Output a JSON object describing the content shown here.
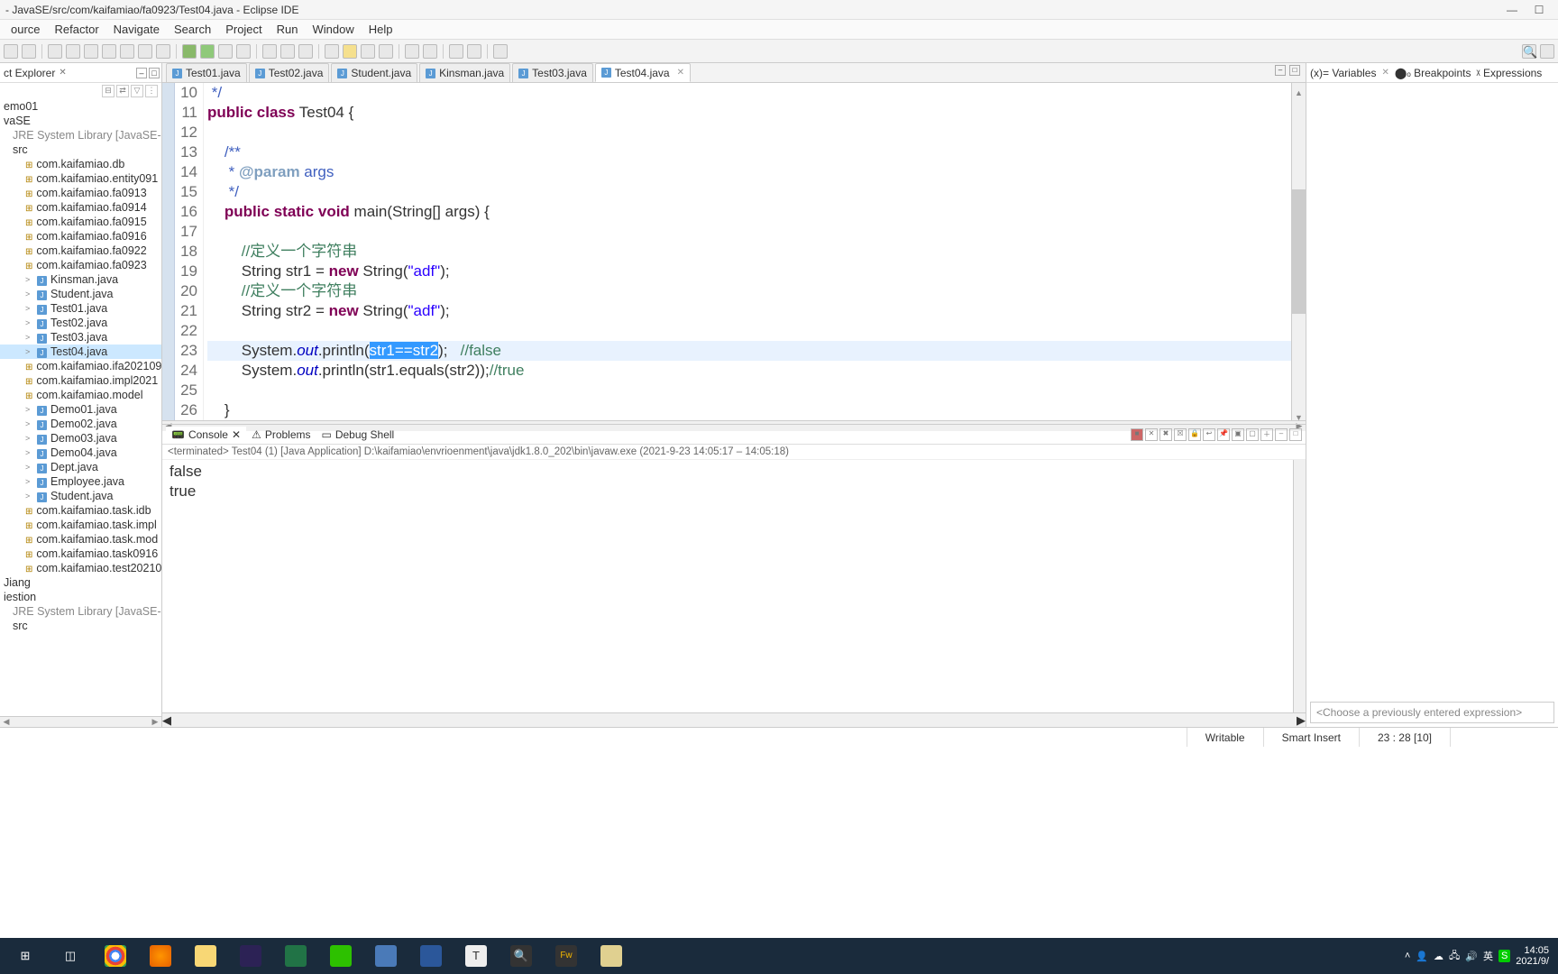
{
  "window": {
    "title": " - JavaSE/src/com/kaifamiao/fa0923/Test04.java - Eclipse IDE",
    "min": "—",
    "max": "☐",
    "close": "✕"
  },
  "menus": [
    "ource",
    "Refactor",
    "Navigate",
    "Search",
    "Project",
    "Run",
    "Window",
    "Help"
  ],
  "explorer": {
    "title": "ct Explorer",
    "items": [
      {
        "t": "emo01",
        "cls": ""
      },
      {
        "t": "vaSE",
        "cls": ""
      },
      {
        "t": "JRE System Library [JavaSE-",
        "cls": "lib-text indent1"
      },
      {
        "t": "src",
        "cls": "indent1"
      },
      {
        "t": "com.kaifamiao.db",
        "cls": "indent2 pkg"
      },
      {
        "t": "com.kaifamiao.entity091",
        "cls": "indent2 pkg"
      },
      {
        "t": "com.kaifamiao.fa0913",
        "cls": "indent2 pkg"
      },
      {
        "t": "com.kaifamiao.fa0914",
        "cls": "indent2 pkg"
      },
      {
        "t": "com.kaifamiao.fa0915",
        "cls": "indent2 pkg"
      },
      {
        "t": "com.kaifamiao.fa0916",
        "cls": "indent2 pkg"
      },
      {
        "t": "com.kaifamiao.fa0922",
        "cls": "indent2 pkg"
      },
      {
        "t": "com.kaifamiao.fa0923",
        "cls": "indent2 pkg"
      },
      {
        "t": "Kinsman.java",
        "cls": "indent2 java",
        "exp": ">"
      },
      {
        "t": "Student.java",
        "cls": "indent2 java",
        "exp": ">"
      },
      {
        "t": "Test01.java",
        "cls": "indent2 java",
        "exp": ">"
      },
      {
        "t": "Test02.java",
        "cls": "indent2 java",
        "exp": ">"
      },
      {
        "t": "Test03.java",
        "cls": "indent2 java",
        "exp": ">"
      },
      {
        "t": "Test04.java",
        "cls": "indent2 java selected",
        "exp": ">"
      },
      {
        "t": "com.kaifamiao.ifa202109",
        "cls": "indent2 pkg"
      },
      {
        "t": "com.kaifamiao.impl2021",
        "cls": "indent2 pkg"
      },
      {
        "t": "com.kaifamiao.model",
        "cls": "indent2 pkg"
      },
      {
        "t": "Demo01.java",
        "cls": "indent2 java",
        "exp": ">"
      },
      {
        "t": "Demo02.java",
        "cls": "indent2 java",
        "exp": ">"
      },
      {
        "t": "Demo03.java",
        "cls": "indent2 java",
        "exp": ">"
      },
      {
        "t": "Demo04.java",
        "cls": "indent2 java",
        "exp": ">"
      },
      {
        "t": "Dept.java",
        "cls": "indent2 java",
        "exp": ">"
      },
      {
        "t": "Employee.java",
        "cls": "indent2 java",
        "exp": ">"
      },
      {
        "t": "Student.java",
        "cls": "indent2 java",
        "exp": ">"
      },
      {
        "t": "com.kaifamiao.task.idb",
        "cls": "indent2 pkg"
      },
      {
        "t": "com.kaifamiao.task.impl",
        "cls": "indent2 pkg"
      },
      {
        "t": "com.kaifamiao.task.mod",
        "cls": "indent2 pkg"
      },
      {
        "t": "com.kaifamiao.task0916",
        "cls": "indent2 pkg"
      },
      {
        "t": "com.kaifamiao.test20210",
        "cls": "indent2 pkg"
      },
      {
        "t": "Jiang",
        "cls": ""
      },
      {
        "t": "iestion",
        "cls": ""
      },
      {
        "t": "JRE System Library [JavaSE-",
        "cls": "lib-text indent1"
      },
      {
        "t": "src",
        "cls": "indent1"
      }
    ]
  },
  "tabs": [
    "Test01.java",
    "Test02.java",
    "Student.java",
    "Kinsman.java",
    "Test03.java",
    "Test04.java"
  ],
  "activeTab": 5,
  "code": {
    "lines": [
      {
        "n": 10,
        "html": " <span class='jdoc'>*/</span>"
      },
      {
        "n": 11,
        "html": "<span class='kw'>public</span> <span class='kw'>class</span> Test04 {"
      },
      {
        "n": 12,
        "html": ""
      },
      {
        "n": 13,
        "html": "    <span class='jdoc'>/**</span>"
      },
      {
        "n": 14,
        "html": "    <span class='jdoc'> * <span class='jdtag'>@param</span> args</span>"
      },
      {
        "n": 15,
        "html": "    <span class='jdoc'> */</span>"
      },
      {
        "n": 16,
        "html": "    <span class='kw'>public</span> <span class='kw'>static</span> <span class='kw'>void</span> main(String[] args) {"
      },
      {
        "n": 17,
        "html": ""
      },
      {
        "n": 18,
        "html": "        <span class='com'>//定义一个字符串</span>"
      },
      {
        "n": 19,
        "html": "        String str1 = <span class='kw'>new</span> String(<span class='str'>\"adf\"</span>);"
      },
      {
        "n": 20,
        "html": "        <span class='com'>//定义一个字符串</span>"
      },
      {
        "n": 21,
        "html": "        String str2 = <span class='kw'>new</span> String(<span class='str'>\"adf\"</span>);"
      },
      {
        "n": 22,
        "html": ""
      },
      {
        "n": 23,
        "hl": true,
        "html": "        System.<span class='fld'>out</span>.println(<span class='sel'>str1==str2</span>);   <span class='com'>//false</span>"
      },
      {
        "n": 24,
        "html": "        System.<span class='fld'>out</span>.println(str1.equals(str2));<span class='com'>//true</span>"
      },
      {
        "n": 25,
        "html": ""
      },
      {
        "n": 26,
        "html": "    }"
      }
    ]
  },
  "console": {
    "tabs": [
      "Console",
      "Problems",
      "Debug Shell"
    ],
    "header": "<terminated> Test04 (1) [Java Application] D:\\kaifamiao\\envrioenment\\java\\jdk1.8.0_202\\bin\\javaw.exe  (2021-9-23 14:05:17 – 14:05:18)",
    "lines": [
      "false",
      "true"
    ]
  },
  "rightTabs": [
    "Variables",
    "Breakpoints",
    "Expressions"
  ],
  "exprHint": "<Choose a previously entered expression>",
  "status": {
    "writable": "Writable",
    "insert": "Smart Insert",
    "pos": "23 : 28 [10]"
  },
  "taskbarTime": "14:05",
  "taskbarDate": "2021/9/"
}
